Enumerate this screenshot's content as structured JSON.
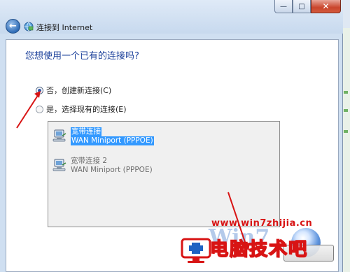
{
  "window": {
    "title": "连接到 Internet",
    "caption_buttons": {
      "minimize": "—",
      "maximize": "□",
      "close": "✕"
    }
  },
  "question": "您想使用一个已有的连接吗?",
  "options": [
    {
      "label": "否，创建新连接(C)",
      "selected": true
    },
    {
      "label": "是，选择现有的连接(E)",
      "selected": false
    }
  ],
  "connections": [
    {
      "name": "宽带连接",
      "device": "WAN Miniport (PPPOE)",
      "selected": true
    },
    {
      "name": "宽带连接 2",
      "device": "WAN Miniport (PPPOE)",
      "selected": false
    }
  ],
  "watermark": {
    "url": "www.win7zhijia.cn",
    "title": "电脑技术吧",
    "win_text": "Win7"
  },
  "colors": {
    "accent": "#3399ff",
    "annotation": "#d81414",
    "question": "#1a3f9a"
  }
}
